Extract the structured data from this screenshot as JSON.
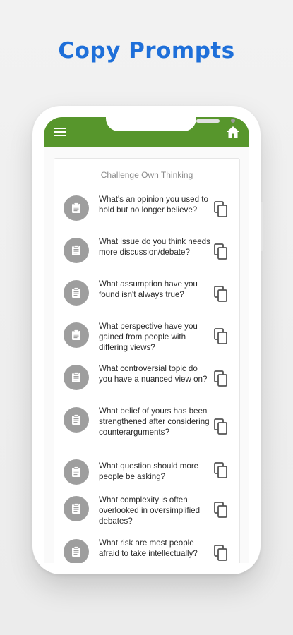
{
  "headline": "Copy Prompts",
  "colors": {
    "headline": "#1e6fd9",
    "app_bar": "#57962c",
    "clipboard_circle": "#9e9e9e"
  },
  "icons": {
    "menu": "menu-icon",
    "home": "home-icon",
    "clipboard": "clipboard-icon",
    "copy": "copy-icon"
  },
  "section_title": "Challenge Own Thinking",
  "prompts": [
    {
      "text": "What's an opinion you used to hold but no longer believe?"
    },
    {
      "text": "What issue do you think needs more discussion/debate?"
    },
    {
      "text": "What assumption have you found isn't always true?"
    },
    {
      "text": "What perspective have you gained from people with differing views?"
    },
    {
      "text": "What controversial topic do you have a nuanced view on?"
    },
    {
      "text": "What belief of yours has been strengthened after considering counterarguments?"
    },
    {
      "text": "What question should more people be asking?"
    },
    {
      "text": "What complexity is often overlooked in oversimplified debates?"
    },
    {
      "text": "What risk are most people afraid to take intellectually?"
    }
  ]
}
